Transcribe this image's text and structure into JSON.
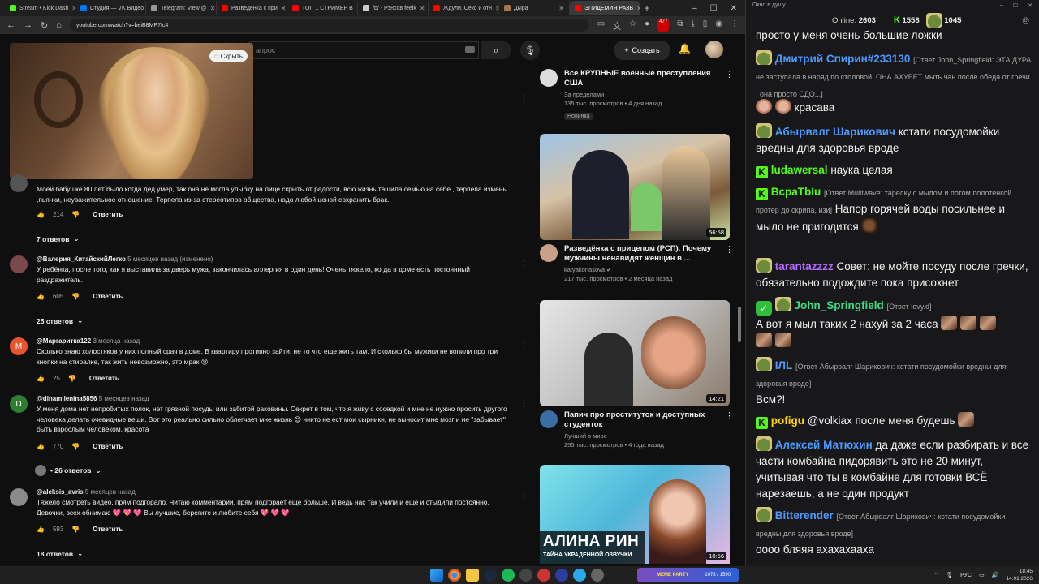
{
  "browser": {
    "tabs": [
      {
        "title": "Stream • Kick Dash",
        "color": "#53fc18"
      },
      {
        "title": "Студия — VK Видео",
        "color": "#0077ff"
      },
      {
        "title": "Telegram: View @",
        "color": "#999999"
      },
      {
        "title": "Разведёнка с при",
        "color": "#ff0000"
      },
      {
        "title": "ТОП 1 СТРИМЕР В",
        "color": "#ff0000"
      },
      {
        "title": "/b/ - Рэнсов feelk",
        "color": "#cccccc"
      },
      {
        "title": "Ждули. Секс и отн",
        "color": "#ff0000"
      },
      {
        "title": "Дыра",
        "color": "#aa7744"
      },
      {
        "title": "ЭПИДЕМИЯ РАЗВ",
        "color": "#ff0000",
        "active": true
      }
    ],
    "url": "youtube.com/watch?v=beiB8MP7Ic4",
    "ext_badge": "477"
  },
  "youtube": {
    "search_placeholder": "апрос",
    "create_label": "Создать",
    "hide_label": "Скрыть"
  },
  "comments": [
    {
      "author": "",
      "time": "",
      "text": "Моей бабушке 80 лет было когда дед умер, так она не могла улыбку на лице скрыть от радости, всю жизнь тащила семью на себе , терпела измены ,пьянки, неуважительное отношение. Терпела из-за стереотипов общества, надо любой ценой сохранить брак.",
      "likes": "214",
      "reply": "Ответить",
      "replies": "7 ответов",
      "avatar_color": "#555555",
      "avatar_letter": ""
    },
    {
      "author": "@Валерия_КитайскийЛегко",
      "time": "5 месяцев назад (изменено)",
      "text": "У ребёнка, после того, как я выставила за дверь мужа, закончилась аллергия в один день! Очень тяжело, когда в доме есть постоянный раздражитель.",
      "likes": "605",
      "reply": "Ответить",
      "replies": "25 ответов",
      "avatar_color": "#7a4a4a",
      "avatar_letter": ""
    },
    {
      "author": "@Маргаритка122",
      "time": "3 месяца назад",
      "text": "Сколько знаю холостяков у них полный срач в доме. В квартиру противно зайти, не то что еще жить там. И сколько бы мужики не вопили про три кнопки на стиралке, так жить невозможно, это мрак 😢",
      "likes": "25",
      "reply": "Ответить",
      "replies": "",
      "avatar_color": "#e8542b",
      "avatar_letter": "М"
    },
    {
      "author": "@dinamilenina5856",
      "time": "5 месяцев назад",
      "text": "У меня дома нет непробитых полок, нет грязной посуды или забитой раковины. Секрет в том, что я живу с соседкой и мне не нужно просить другого человека делать очевидные вещи. Вот это реально сильно облегчает мне жизнь 😊 никто не ест мои сырники, не выносит мне мозг и не \"забывает\" быть взрослым человеком, красота",
      "likes": "770",
      "reply": "Ответить",
      "replies": "• 26 ответов",
      "avatar_color": "#2e7d32",
      "avatar_letter": "D"
    },
    {
      "author": "@aleksis_avris",
      "time": "5 месяцев назад",
      "text": "Тяжело смотреть видео, прям подгорало. Читаю комментарии, прям подгорает еще больше. И ведь нас так учили и еще и стыдили постоянно. Девочки, всех обнимаю 💖 💖 💖 Вы лучшие, берегите и любите себя 💖 💖 💖",
      "likes": "593",
      "reply": "Ответить",
      "replies": "18 ответов",
      "avatar_color": "#8a8a8a",
      "avatar_letter": ""
    }
  ],
  "recommendations": [
    {
      "title": "Все КРУПНЫЕ военные преступления США",
      "channel": "За пределами",
      "stats": "135 тыс. просмотров • 4 дня назад",
      "badge": "Новинка",
      "duration": ""
    },
    {
      "title": "Разведёнка с прицепом (РСП). Почему мужчины ненавидят женщин в ...",
      "channel": "katyakonasova ✔",
      "stats": "217 тыс. просмотров • 2 месяца назад",
      "badge": "",
      "duration": "56:58"
    },
    {
      "title": "Папич про проституток и доступных студенток",
      "channel": "Лучший в мире",
      "stats": "255 тыс. просмотров • 4 года назад",
      "badge": "",
      "duration": "14:21"
    },
    {
      "title": "",
      "channel": "",
      "stats": "",
      "badge": "",
      "duration": "10:56",
      "thumb_text": "АЛИНА РИН",
      "thumb_sub": "ТАЙНА УКРАДЕННОЙ ОЗВУЧКИ"
    }
  ],
  "chat": {
    "window_title": "Окно в душу",
    "online_label": "Online:",
    "online": "2603",
    "kick_count": "1558",
    "pepe_count": "1045",
    "messages": [
      {
        "user": "",
        "color": "#ffffff",
        "reply": "",
        "text": "просто у меня очень большие ложки"
      },
      {
        "user": "Дмитрий Спирин#233130",
        "color": "#4b9bff",
        "reply": "[Ответ John_Springfield: ЭТА ДУРА не заступала в наряд по столовой. ОНА АХУЕЕТ мыть чан после обеда от гречи , она просто СДО...]",
        "text": ""
      },
      {
        "user": "",
        "color": "#ffffff",
        "reply": "",
        "text": "красава"
      },
      {
        "user": "Абырвалг Шарикович",
        "color": "#4b9bff",
        "reply": "",
        "text": "кстати посудомойки вредны для здоровья вроде"
      },
      {
        "user": "ludawersal",
        "color": "#53fc18",
        "reply": "",
        "text": "наука целая"
      },
      {
        "user": "ВсраТbIu",
        "color": "#53fc18",
        "reply": "[Ответ Multiwave: тарелку с мылом и потом полотенкой протер до скрипа, изи]",
        "text": "Напор горячей воды посильнее и мыло не пригодится"
      },
      {
        "user": "tarantazzzz",
        "color": "#b26bff",
        "reply": "",
        "text": "Совет: не мойте посуду после гречки, обязательно подождите пока присохнет"
      },
      {
        "user": "John_Springfield",
        "color": "#3ddc84",
        "reply": "[Ответ levy.d]",
        "text": "А вот я мыл таких 2 нахуй за 2 часа"
      },
      {
        "user": "IЛL",
        "color": "#4b9bff",
        "reply": "[Ответ Абырвалг Шарикович: кстати посудомойки вредны для здоровья вроде]",
        "text": "Всм?!"
      },
      {
        "user": "pofigu",
        "color": "#ffd400",
        "reply": "",
        "text": "@volkiax после меня будешь"
      },
      {
        "user": "Алексей Матюхин",
        "color": "#4b9bff",
        "reply": "",
        "text": "да даже если разбирать и все части комбайна пидорявить это не 20 минут, учитывая что ты в комбайне для готовки ВСЁ нарезаешь, а не один продукт"
      },
      {
        "user": "Bitterender",
        "color": "#4b9bff",
        "reply": "[Ответ Абырвалг Шарикович: кстати посудомойки вредны для здоровья вроде]",
        "text": "оооо бляяя ахахахаахa"
      }
    ]
  },
  "taskbar": {
    "meme_label": "MEME PARTY",
    "meme_count": "1078 / 1590",
    "lang": "РУС",
    "time": "18:45",
    "date": "14.01.2026"
  }
}
